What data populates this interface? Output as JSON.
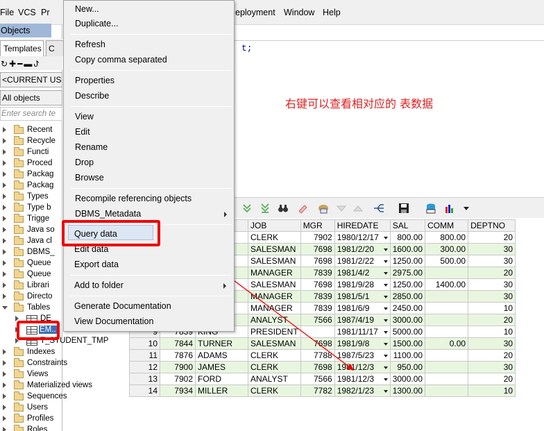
{
  "menubar": {
    "items": [
      "File",
      "VCS",
      "Pr",
      "eployment",
      "Window",
      "Help"
    ]
  },
  "left_panel": {
    "title": "Objects",
    "tabs": [
      "Templates",
      "C"
    ],
    "toolbar_glyphs": "↻✚━▬ꚠ",
    "user_combo": "<CURRENT US",
    "objects_combo": "All objects",
    "filter_placeholder": "Enter search te",
    "tree": [
      {
        "label": "Recent"
      },
      {
        "label": "Recycle"
      },
      {
        "label": "Functi"
      },
      {
        "label": "Proced"
      },
      {
        "label": "Packag"
      },
      {
        "label": "Packag"
      },
      {
        "label": "Types"
      },
      {
        "label": "Type b"
      },
      {
        "label": "Trigge"
      },
      {
        "label": "Java so"
      },
      {
        "label": "Java cl"
      },
      {
        "label": "DBMS_"
      },
      {
        "label": "Queue"
      },
      {
        "label": "Queue"
      },
      {
        "label": "Librari"
      },
      {
        "label": "Directo"
      },
      {
        "label": "Tables"
      }
    ],
    "table_children": [
      "DE",
      "EM..",
      "T_STUDENT_TMP"
    ],
    "tree_after": [
      "Indexes",
      "Constraints",
      "Views",
      "Materialized views",
      "Sequences",
      "Users",
      "Profiles",
      "Roles"
    ]
  },
  "editor": {
    "code": "t;"
  },
  "annotation": "右键可以查看相对应的 表数据",
  "context_menu": {
    "new": "New...",
    "duplicate": "Duplicate...",
    "refresh": "Refresh",
    "copy_comma": "Copy comma separated",
    "properties": "Properties",
    "describe": "Describe",
    "view": "View",
    "edit": "Edit",
    "rename": "Rename",
    "drop": "Drop",
    "browse": "Browse",
    "recompile": "Recompile referencing objects",
    "dbms_metadata": "DBMS_Metadata",
    "query_data": "Query data",
    "edit_data": "Edit data",
    "export_data": "Export data",
    "add_to_folder": "Add to folder",
    "generate_doc": "Generate Documentation",
    "view_doc": "View Documentation"
  },
  "grid": {
    "columns": [
      "JOB",
      "MGR",
      "HIREDATE",
      "SAL",
      "COMM",
      "DEPTNO"
    ],
    "rows": [
      {
        "rn": "",
        "empno": "",
        "ename": "",
        "job": "CLERK",
        "mgr": "7902",
        "hiredate": "1980/12/17",
        "sal": "800.00",
        "comm": "800.00",
        "deptno": "20"
      },
      {
        "rn": "",
        "empno": "",
        "ename": "",
        "job": "SALESMAN",
        "mgr": "7698",
        "hiredate": "1981/2/20",
        "sal": "1600.00",
        "comm": "300.00",
        "deptno": "30"
      },
      {
        "rn": "",
        "empno": "",
        "ename": "",
        "job": "SALESMAN",
        "mgr": "7698",
        "hiredate": "1981/2/22",
        "sal": "1250.00",
        "comm": "500.00",
        "deptno": "30"
      },
      {
        "rn": "",
        "empno": "",
        "ename": "",
        "job": "MANAGER",
        "mgr": "7839",
        "hiredate": "1981/4/2",
        "sal": "2975.00",
        "comm": "",
        "deptno": "20"
      },
      {
        "rn": "",
        "empno": "",
        "ename": "N",
        "job": "SALESMAN",
        "mgr": "7698",
        "hiredate": "1981/9/28",
        "sal": "1250.00",
        "comm": "1400.00",
        "deptno": "30"
      },
      {
        "rn": "",
        "empno": "",
        "ename": "",
        "job": "MANAGER",
        "mgr": "7839",
        "hiredate": "1981/5/1",
        "sal": "2850.00",
        "comm": "",
        "deptno": "30"
      },
      {
        "rn": "",
        "empno": "",
        "ename": "",
        "job": "MANAGER",
        "mgr": "7839",
        "hiredate": "1981/6/9",
        "sal": "2450.00",
        "comm": "",
        "deptno": "10"
      },
      {
        "rn": "",
        "empno": "",
        "ename": "",
        "job": "ANALYST",
        "mgr": "7566",
        "hiredate": "1987/4/19",
        "sal": "3000.00",
        "comm": "",
        "deptno": "20"
      },
      {
        "rn": "9",
        "empno": "7839",
        "ename": "KING",
        "job": "PRESIDENT",
        "mgr": "",
        "hiredate": "1981/11/17",
        "sal": "5000.00",
        "comm": "",
        "deptno": "10"
      },
      {
        "rn": "10",
        "empno": "7844",
        "ename": "TURNER",
        "job": "SALESMAN",
        "mgr": "7698",
        "hiredate": "1981/9/8",
        "sal": "1500.00",
        "comm": "0.00",
        "deptno": "30"
      },
      {
        "rn": "11",
        "empno": "7876",
        "ename": "ADAMS",
        "job": "CLERK",
        "mgr": "7788",
        "hiredate": "1987/5/23",
        "sal": "1100.00",
        "comm": "",
        "deptno": "20"
      },
      {
        "rn": "12",
        "empno": "7900",
        "ename": "JAMES",
        "job": "CLERK",
        "mgr": "7698",
        "hiredate": "1981/12/3",
        "sal": "950.00",
        "comm": "",
        "deptno": "30"
      },
      {
        "rn": "13",
        "empno": "7902",
        "ename": "FORD",
        "job": "ANALYST",
        "mgr": "7566",
        "hiredate": "1981/12/3",
        "sal": "3000.00",
        "comm": "",
        "deptno": "20"
      },
      {
        "rn": "14",
        "empno": "7934",
        "ename": "MILLER",
        "job": "CLERK",
        "mgr": "7782",
        "hiredate": "1982/1/23",
        "sal": "1300.00",
        "comm": "",
        "deptno": "10"
      }
    ]
  },
  "colors": {
    "annotation_red": "#ee0000",
    "row_alt": "#e8f6e0",
    "title_bar": "#9fb8d8"
  }
}
